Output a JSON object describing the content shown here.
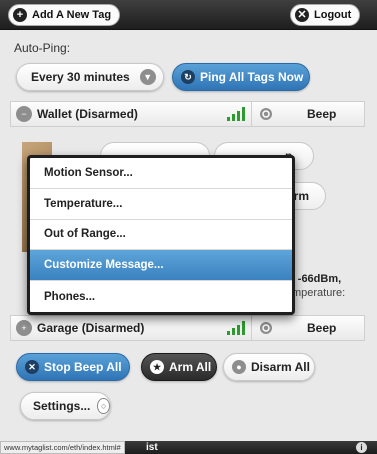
{
  "topbar": {
    "add_tag_label": "Add A New Tag",
    "logout_label": "Logout"
  },
  "autoping": {
    "label": "Auto-Ping:",
    "interval_value": "Every 30 minutes",
    "ping_all_label": "Ping All Tags Now"
  },
  "tags": [
    {
      "name": "Wallet (Disarmed)",
      "beep_label": "Beep",
      "signal_bars": 4
    },
    {
      "name": "Garage (Disarmed)",
      "beep_label": "Beep",
      "signal_bars": 4
    }
  ],
  "behind_menu": {
    "partial_button_1": "p",
    "partial_button_2": "arm",
    "partial_text_1": "l: -66dBm,",
    "partial_text_2": "mperature:"
  },
  "menu": {
    "items": [
      {
        "label": "Motion Sensor..."
      },
      {
        "label": "Temperature..."
      },
      {
        "label": "Out of Range..."
      },
      {
        "label": "Customize Message..."
      },
      {
        "label": "Phones..."
      }
    ],
    "selected_index": 3
  },
  "actions": {
    "stop_beep_all": "Stop Beep All",
    "arm_all": "Arm All",
    "disarm_all": "Disarm All",
    "settings": "Settings..."
  },
  "footer": {
    "status_url": "www.mytaglist.com/eth/index.html#",
    "label": "ist"
  },
  "colors": {
    "accent_blue": "#3a82c0",
    "signal_green": "#2f9a2f",
    "dark_bar": "#2a2a2a"
  }
}
